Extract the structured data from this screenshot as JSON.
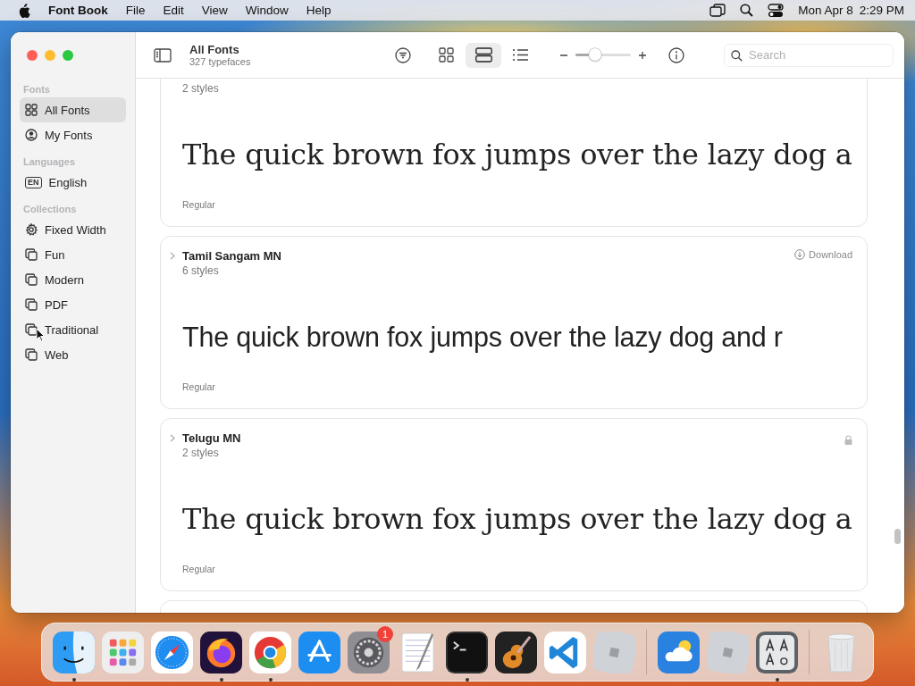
{
  "menubar": {
    "app_name": "Font Book",
    "menus": [
      "File",
      "Edit",
      "View",
      "Window",
      "Help"
    ],
    "date": "Mon Apr 8",
    "time": "2:29 PM"
  },
  "toolbar": {
    "title": "All Fonts",
    "subtitle": "327 typefaces",
    "views": [
      {
        "kind": "grid",
        "selected": false
      },
      {
        "kind": "samples",
        "selected": true
      },
      {
        "kind": "list",
        "selected": false
      }
    ],
    "size_slider": {
      "level": 0.35
    },
    "search": {
      "placeholder": "Search"
    }
  },
  "sidebar": {
    "sections": [
      {
        "heading": "Fonts",
        "items": [
          {
            "label": "All Fonts",
            "kind": "grid",
            "selected": true
          },
          {
            "label": "My Fonts",
            "kind": "person",
            "selected": false
          }
        ]
      },
      {
        "heading": "Languages",
        "items": [
          {
            "label": "English",
            "kind": "language",
            "badge": "EN",
            "selected": false
          }
        ]
      },
      {
        "heading": "Collections",
        "items": [
          {
            "label": "Fixed Width",
            "kind": "smart",
            "selected": false
          },
          {
            "label": "Fun",
            "kind": "collection",
            "selected": false
          },
          {
            "label": "Modern",
            "kind": "collection",
            "selected": false
          },
          {
            "label": "PDF",
            "kind": "collection",
            "selected": false
          },
          {
            "label": "Traditional",
            "kind": "collection",
            "selected": false
          },
          {
            "label": "Web",
            "kind": "collection",
            "selected": false
          }
        ]
      }
    ]
  },
  "font_cards": [
    {
      "kind": "serif",
      "styles": "2 styles",
      "sample": "The quick brown fox jumps over the lazy dog a",
      "style_name": "Regular"
    },
    {
      "kind": "sans",
      "name": "Tamil Sangam MN",
      "styles": "6 styles",
      "status": {
        "kind": "download",
        "label": "Download"
      },
      "sample": "The quick brown fox jumps over the lazy dog and r",
      "style_name": "Regular"
    },
    {
      "kind": "serif",
      "name": "Telugu MN",
      "styles": "2 styles",
      "status": {
        "kind": "locked"
      },
      "sample": "The quick brown fox jumps over the lazy dog a",
      "style_name": "Regular"
    }
  ],
  "dock": {
    "items": [
      {
        "kind": "finder",
        "running": true
      },
      {
        "kind": "launchpad",
        "running": false
      },
      {
        "kind": "safari",
        "running": false
      },
      {
        "kind": "firefox",
        "running": true
      },
      {
        "kind": "chrome",
        "running": true
      },
      {
        "kind": "appstore",
        "running": false
      },
      {
        "kind": "settings",
        "running": false,
        "badge": "1"
      },
      {
        "kind": "textedit",
        "running": false
      },
      {
        "kind": "terminal",
        "running": true
      },
      {
        "kind": "garageband",
        "running": false
      },
      {
        "kind": "vscode",
        "running": false
      },
      {
        "kind": "roblox",
        "running": false
      },
      {
        "kind": "separator"
      },
      {
        "kind": "weather",
        "running": false
      },
      {
        "kind": "roblox",
        "running": false
      },
      {
        "kind": "fontbook",
        "running": true
      },
      {
        "kind": "separator"
      },
      {
        "kind": "trash",
        "running": false
      }
    ]
  }
}
